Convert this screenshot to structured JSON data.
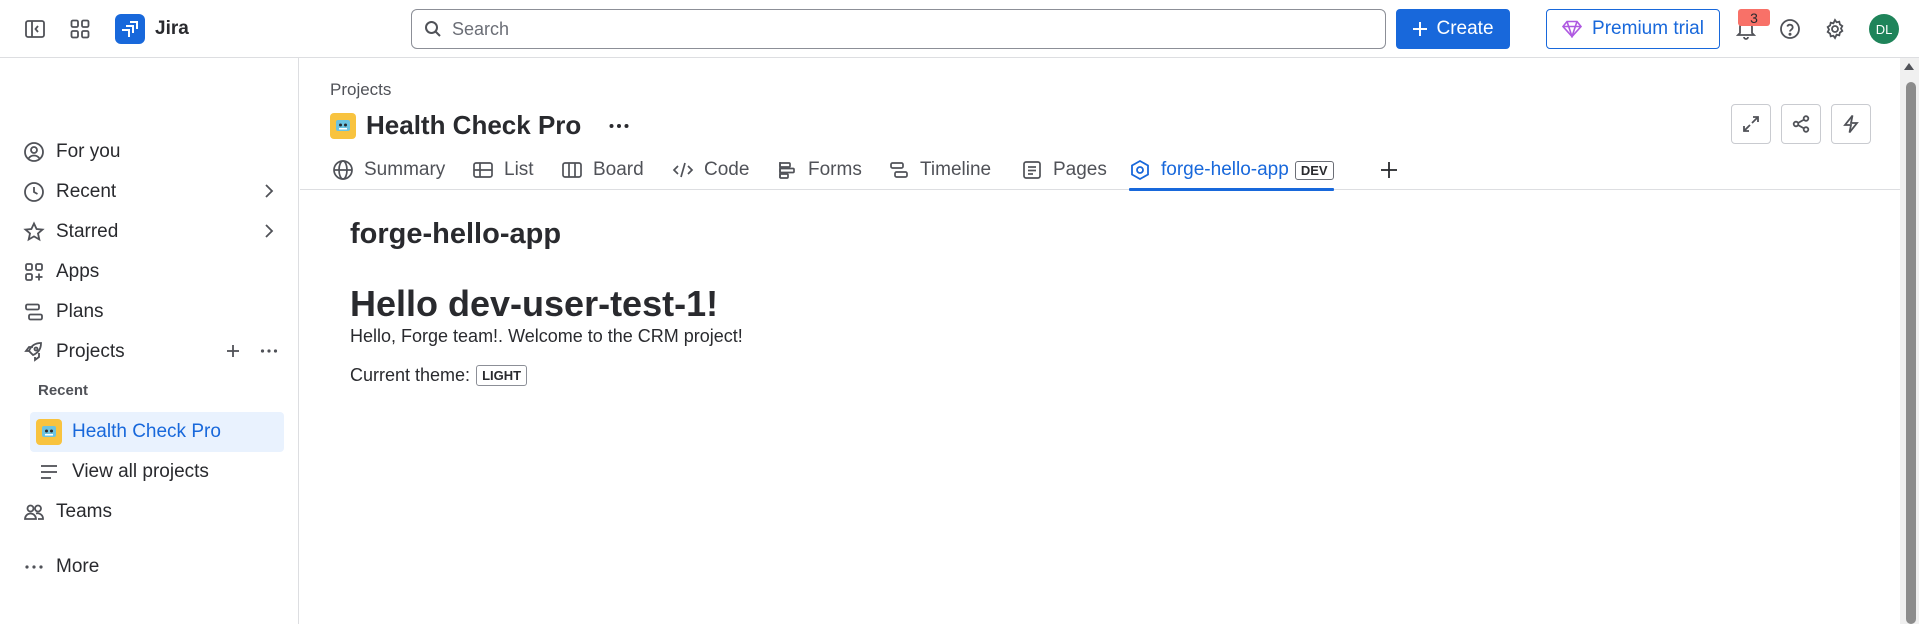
{
  "app": {
    "name": "Jira"
  },
  "search": {
    "placeholder": "Search",
    "value": ""
  },
  "topbar": {
    "create_label": "Create",
    "premium_label": "Premium trial",
    "notification_count": "3",
    "avatar_initials": "DL"
  },
  "sidebar": {
    "for_you": "For you",
    "recent": "Recent",
    "starred": "Starred",
    "apps": "Apps",
    "plans": "Plans",
    "projects": "Projects",
    "recent_heading": "Recent",
    "recent_project": "Health Check Pro",
    "view_all": "View all projects",
    "teams": "Teams",
    "more": "More"
  },
  "header": {
    "breadcrumb": "Projects",
    "project_title": "Health Check Pro"
  },
  "tabs": [
    {
      "label": "Summary",
      "icon": "globe-icon"
    },
    {
      "label": "List",
      "icon": "list-icon"
    },
    {
      "label": "Board",
      "icon": "board-icon"
    },
    {
      "label": "Code",
      "icon": "code-icon"
    },
    {
      "label": "Forms",
      "icon": "forms-icon"
    },
    {
      "label": "Timeline",
      "icon": "timeline-icon"
    },
    {
      "label": "Pages",
      "icon": "pages-icon"
    },
    {
      "label": "forge-hello-app",
      "icon": "app-icon",
      "badge": "DEV",
      "active": true
    }
  ],
  "content": {
    "app_title": "forge-hello-app",
    "greeting": "Hello dev-user-test-1!",
    "welcome": "Hello, Forge team!. Welcome to the CRM project!",
    "theme_label": "Current theme:",
    "theme_value": "LIGHT"
  },
  "colors": {
    "brand": "#1868db",
    "active_bg": "#e9f2fe",
    "badge_red": "#f87168",
    "avatar_green": "#1f845a",
    "project_yellow": "#f8c33f"
  }
}
